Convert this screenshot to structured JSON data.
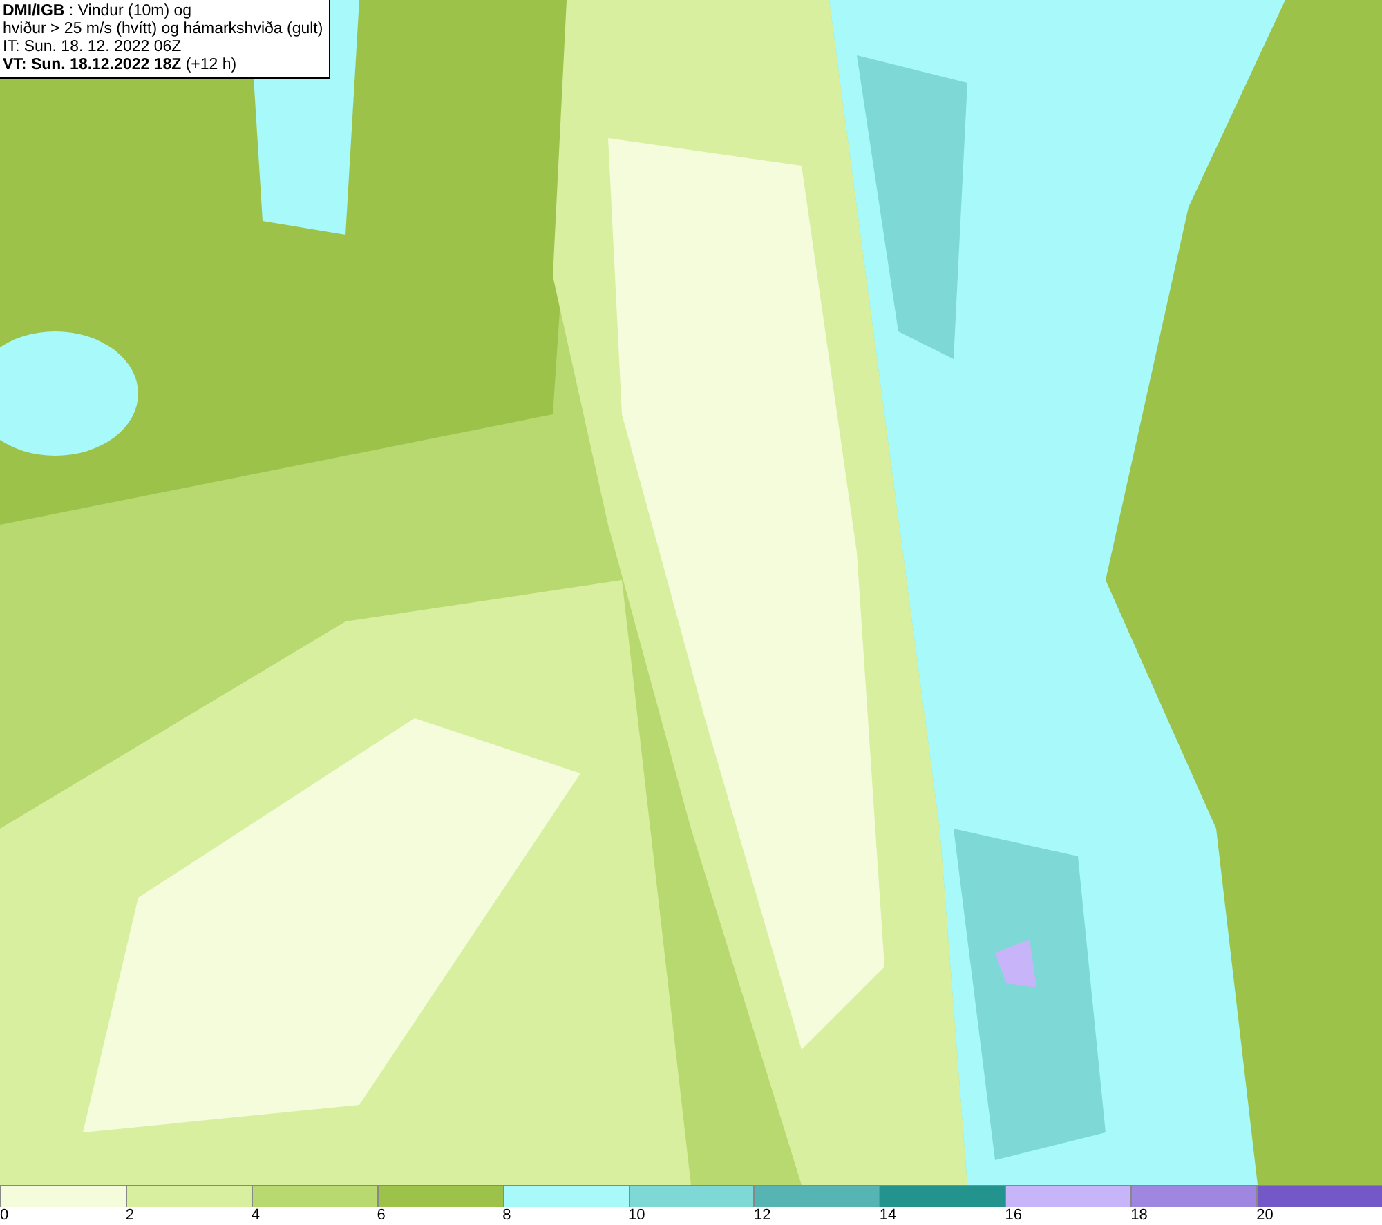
{
  "header": {
    "lines": [
      "**DMI/IGB** : Vindur (10m) og",
      "hviður > 25 m/s (hvítt) og hámarkshviða (gult)",
      "IT: Sun. 18. 12. 2022 06Z",
      "**VT: Sun. 18.12.2022 18Z** (+12 h)"
    ]
  },
  "legend": {
    "swatches": [
      {
        "color": "#f5fcdc",
        "label": "0"
      },
      {
        "color": "#d8efa0",
        "label": "2"
      },
      {
        "color": "#b7d96f",
        "label": "4"
      },
      {
        "color": "#9cc24a",
        "label": "6"
      },
      {
        "color": "#a8fafa",
        "label": "8"
      },
      {
        "color": "#7ed8d6",
        "label": "10"
      },
      {
        "color": "#56b5b3",
        "label": "12"
      },
      {
        "color": "#23938e",
        "label": "14"
      },
      {
        "color": "#c8b4f8",
        "label": "16"
      },
      {
        "color": "#9f86e0",
        "label": "18"
      },
      {
        "color": "#7558c8",
        "label": "20"
      }
    ]
  }
}
